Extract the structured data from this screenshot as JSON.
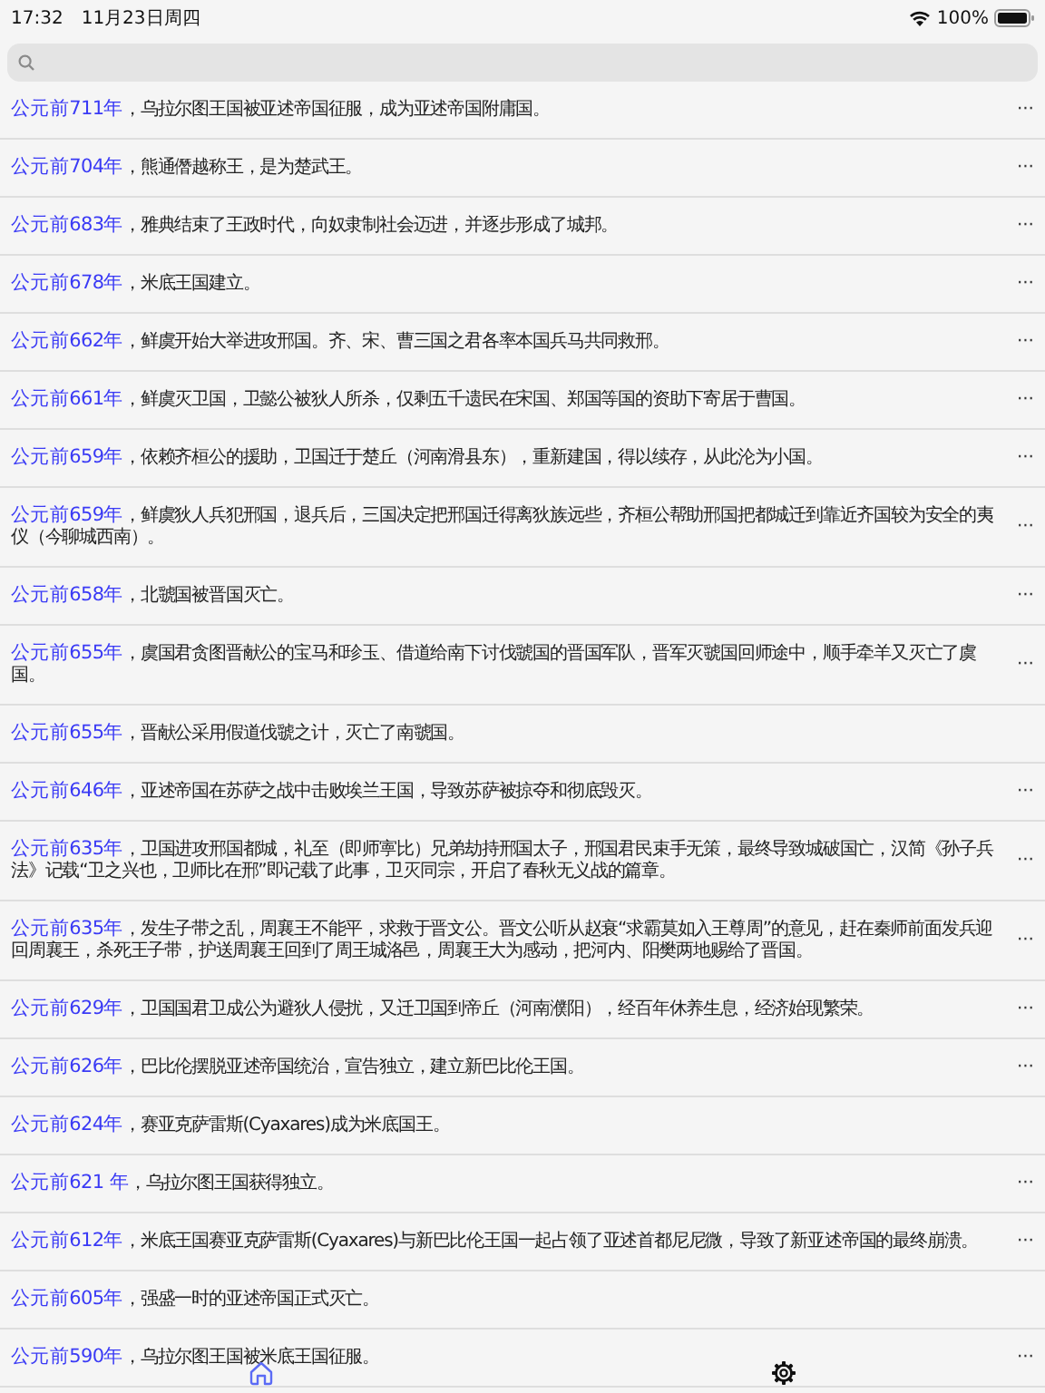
{
  "status_bar": {
    "time": "17:32",
    "date": "11月23日周四",
    "battery": "100%"
  },
  "events": [
    {
      "year": "公元前711年",
      "text": "，乌拉尔图王国被亚述帝国征服，成为亚述帝国附庸国。",
      "more": "···"
    },
    {
      "year": "公元前704年",
      "text": "，熊通僭越称王，是为楚武王。",
      "more": "···"
    },
    {
      "year": "公元前683年",
      "text": "，雅典结束了王政时代，向奴隶制社会迈进，并逐步形成了城邦。",
      "more": "···"
    },
    {
      "year": "公元前678年",
      "text": "，米底王国建立。",
      "more": "···"
    },
    {
      "year": "公元前662年",
      "text": "，鲜虞开始大举进攻邢国。齐、宋、曹三国之君各率本国兵马共同救邢。",
      "more": "···"
    },
    {
      "year": "公元前661年",
      "text": "，鲜虞灭卫国，卫懿公被狄人所杀，仅剩五千遗民在宋国、郑国等国的资助下寄居于曹国。",
      "more": "···"
    },
    {
      "year": "公元前659年",
      "text": "，依赖齐桓公的援助，卫国迁于楚丘（河南滑县东），重新建国，得以续存，从此沦为小国。",
      "more": "···"
    },
    {
      "year": "公元前659年",
      "text": "，鲜虞狄人兵犯邢国，退兵后，三国决定把邢国迁得离狄族远些，齐桓公帮助邢国把都城迁到靠近齐国较为安全的夷仪（今聊城西南）。",
      "more": "···"
    },
    {
      "year": "公元前658年",
      "text": "，北虢国被晋国灭亡。",
      "more": "···"
    },
    {
      "year": "公元前655年",
      "text": "，虞国君贪图晋献公的宝马和珍玉、借道给南下讨伐虢国的晋国军队，晋军灭虢国回师途中，顺手牵羊又灭亡了虞国。",
      "more": "···"
    },
    {
      "year": "公元前655年",
      "text": "，晋献公采用假道伐虢之计，灭亡了南虢国。"
    },
    {
      "year": "公元前646年",
      "text": "，亚述帝国在苏萨之战中击败埃兰王国，导致苏萨被掠夺和彻底毁灭。",
      "more": "···"
    },
    {
      "year": "公元前635年",
      "text": "，卫国进攻邢国都城，礼至（即师寕比）兄弟劫持邢国太子，邢国君民束手无策，最终导致城破国亡，汉简《孙子兵法》记载“卫之兴也，卫师比在邢”即记载了此事，卫灭同宗，开启了春秋无义战的篇章。",
      "more": "···"
    },
    {
      "year": "公元前635年",
      "text": "，发生子带之乱，周襄王不能平，求救于晋文公。晋文公听从赵衰“求霸莫如入王尊周”的意见，赶在秦师前面发兵迎回周襄王，杀死王子带，护送周襄王回到了周王城洛邑，周襄王大为感动，把河内、阳樊两地赐给了晋国。",
      "more": "···"
    },
    {
      "year": "公元前629年",
      "text": "，卫国国君卫成公为避狄人侵扰，又迁卫国到帝丘（河南濮阳），经百年休养生息，经济始现繁荣。",
      "more": "···"
    },
    {
      "year": "公元前626年",
      "text": "，巴比伦摆脱亚述帝国统治，宣告独立，建立新巴比伦王国。",
      "more": "···"
    },
    {
      "year": "公元前624年",
      "text": "，赛亚克萨雷斯(Cyaxares)成为米底国王。"
    },
    {
      "year": "公元前621 年",
      "text": "，乌拉尔图王国获得独立。",
      "more": "···"
    },
    {
      "year": "公元前612年",
      "text": "，米底王国赛亚克萨雷斯(Cyaxares)与新巴比伦王国一起占领了亚述首都尼尼微，导致了新亚述帝国的最终崩溃。",
      "more": "···"
    },
    {
      "year": "公元前605年",
      "text": "，强盛一时的亚述帝国正式灭亡。"
    },
    {
      "year": "公元前590年",
      "text": "，乌拉尔图王国被米底王国征服。",
      "more": "···"
    }
  ],
  "tabs": [
    {
      "kind": "home",
      "selected": true
    },
    {
      "kind": "settings",
      "selected": false
    }
  ]
}
